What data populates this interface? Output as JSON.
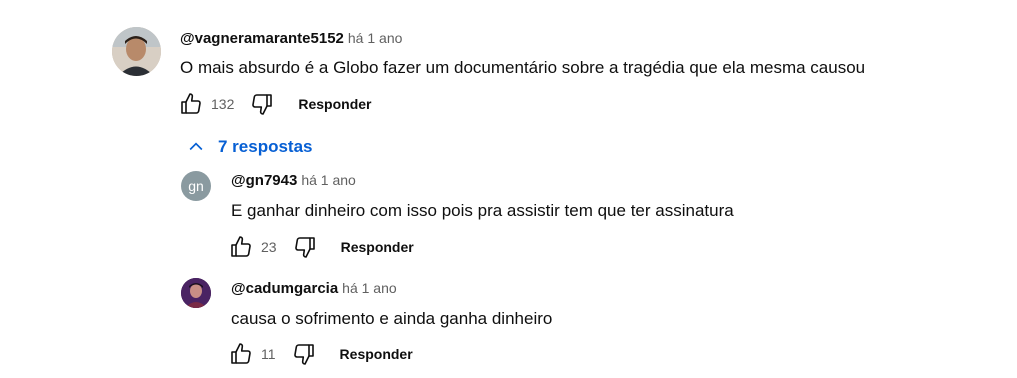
{
  "comments": [
    {
      "author": "@vagneramarante5152",
      "time": "há 1 ano",
      "text": "O mais absurdo é a Globo fazer um documentário sobre a tragédia que ela mesma causou",
      "likes": "132",
      "reply_label": "Responder"
    }
  ],
  "replies_toggle": {
    "label": "7 respostas"
  },
  "replies": [
    {
      "author": "@gn7943",
      "time": "há 1 ano",
      "avatar_initials": "gn",
      "text": "E ganhar dinheiro com isso pois pra assistir tem que ter assinatura",
      "likes": "23",
      "reply_label": "Responder"
    },
    {
      "author": "@cadumgarcia",
      "time": "há 1 ano",
      "text": "causa o sofrimento e ainda ganha dinheiro",
      "likes": "11",
      "reply_label": "Responder"
    }
  ],
  "colors": {
    "link_blue": "#065fd4",
    "muted": "#606060",
    "gn_avatar": "#8a9aa0"
  },
  "icons": [
    "thumbs-up-icon",
    "thumbs-down-icon",
    "chevron-up-icon"
  ]
}
